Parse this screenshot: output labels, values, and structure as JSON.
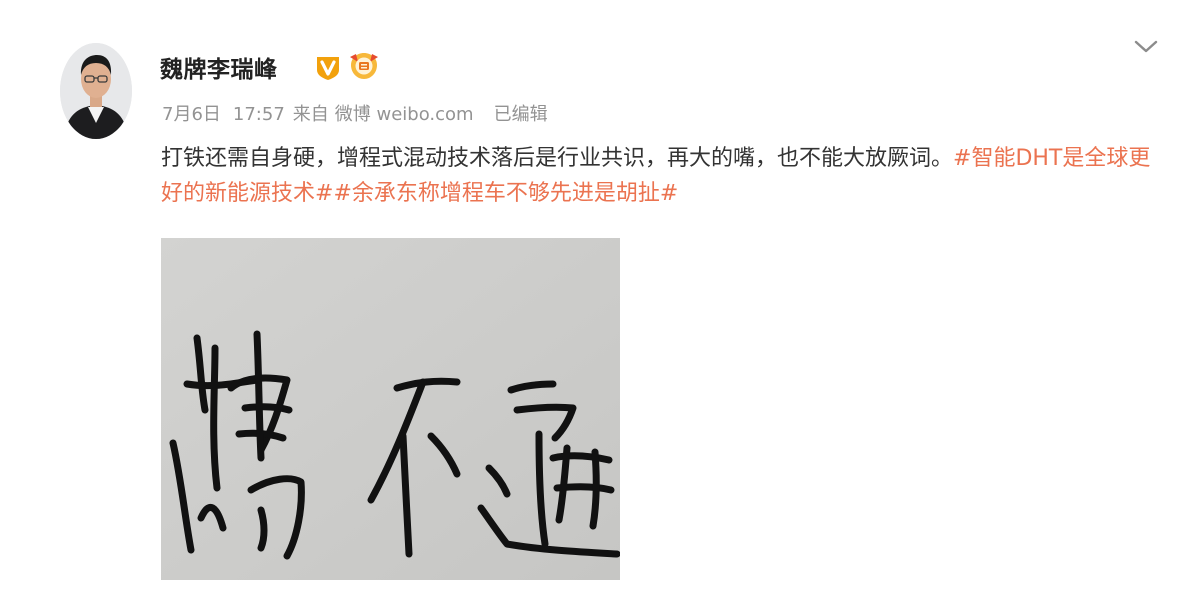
{
  "post": {
    "author": {
      "name": "魏牌李瑞峰",
      "verified_badge_icon": "verified-v-badge-icon",
      "medal_icon": "fan-medal-icon",
      "verified_color": "#f2a10c",
      "medal_color": "#f7b83a"
    },
    "meta": {
      "date": "7月6日",
      "time": "17:57",
      "from_label": "来自",
      "source": "微博 weibo.com",
      "edited": "已编辑"
    },
    "text_plain": "打铁还需自身硬，增程式混动技术落后是行业共识，再大的嘴，也不能大放厥词。",
    "hashtags": [
      "#智能DHT是全球更好的新能源技术#",
      "#余承东称增程车不够先进是胡扯#"
    ],
    "hashtag_color": "#eb7350",
    "image": {
      "type": "handwriting-photo",
      "description_icon": "handwritten-calligraphy-image"
    },
    "menu_icon": "chevron-down-icon"
  }
}
